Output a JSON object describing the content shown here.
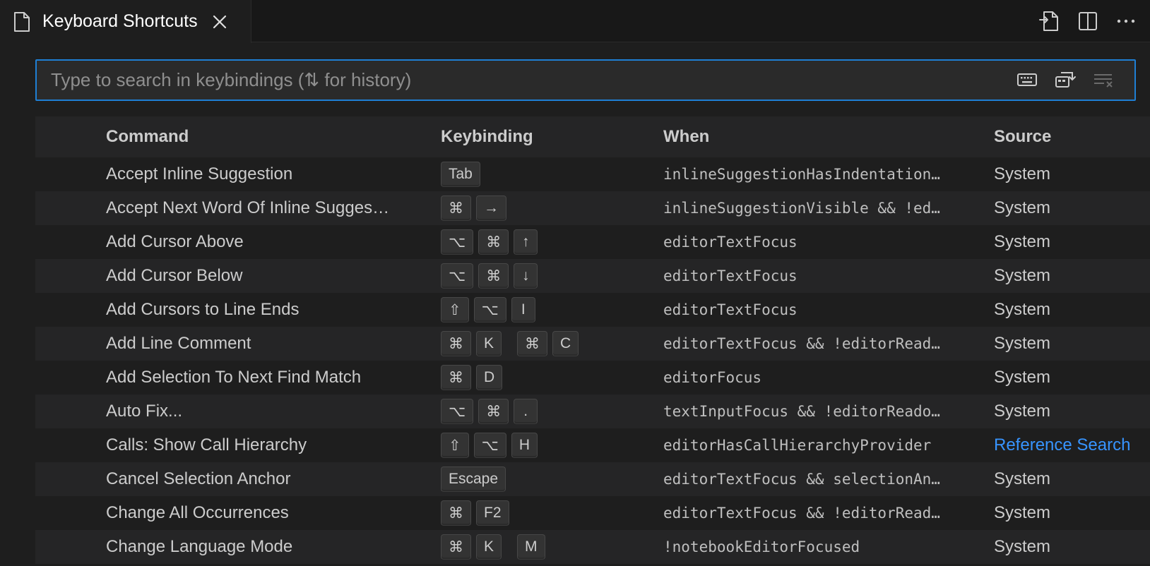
{
  "tab": {
    "title": "Keyboard Shortcuts",
    "file_icon": "file-icon",
    "close_icon": "close-icon"
  },
  "tab_actions": [
    "open-json-icon",
    "split-editor-icon",
    "more-actions-icon"
  ],
  "search": {
    "placeholder": "Type to search in keybindings (⇅ for history)",
    "value": "",
    "actions": [
      "keyboard-icon",
      "sort-by-precedence-icon",
      "clear-search-icon"
    ]
  },
  "table": {
    "headers": {
      "command": "Command",
      "keybinding": "Keybinding",
      "when": "When",
      "source": "Source"
    },
    "rows": [
      {
        "command": "Accept Inline Suggestion",
        "keys": [
          [
            "Tab"
          ]
        ],
        "when": "inlineSuggestionHasIndentation…",
        "source": "System",
        "source_link": false
      },
      {
        "command": "Accept Next Word Of Inline Sugges…",
        "keys": [
          [
            "⌘",
            "→"
          ]
        ],
        "when": "inlineSuggestionVisible && !ed…",
        "source": "System",
        "source_link": false
      },
      {
        "command": "Add Cursor Above",
        "keys": [
          [
            "⌥",
            "⌘",
            "↑"
          ]
        ],
        "when": "editorTextFocus",
        "source": "System",
        "source_link": false
      },
      {
        "command": "Add Cursor Below",
        "keys": [
          [
            "⌥",
            "⌘",
            "↓"
          ]
        ],
        "when": "editorTextFocus",
        "source": "System",
        "source_link": false
      },
      {
        "command": "Add Cursors to Line Ends",
        "keys": [
          [
            "⇧",
            "⌥",
            "I"
          ]
        ],
        "when": "editorTextFocus",
        "source": "System",
        "source_link": false
      },
      {
        "command": "Add Line Comment",
        "keys": [
          [
            "⌘",
            "K"
          ],
          [
            "⌘",
            "C"
          ]
        ],
        "when": "editorTextFocus && !editorRead…",
        "source": "System",
        "source_link": false
      },
      {
        "command": "Add Selection To Next Find Match",
        "keys": [
          [
            "⌘",
            "D"
          ]
        ],
        "when": "editorFocus",
        "source": "System",
        "source_link": false
      },
      {
        "command": "Auto Fix...",
        "keys": [
          [
            "⌥",
            "⌘",
            "."
          ]
        ],
        "when": "textInputFocus && !editorReado…",
        "source": "System",
        "source_link": false
      },
      {
        "command": "Calls: Show Call Hierarchy",
        "keys": [
          [
            "⇧",
            "⌥",
            "H"
          ]
        ],
        "when": "editorHasCallHierarchyProvider",
        "source": "Reference Search",
        "source_link": true
      },
      {
        "command": "Cancel Selection Anchor",
        "keys": [
          [
            "Escape"
          ]
        ],
        "when": "editorTextFocus && selectionAn…",
        "source": "System",
        "source_link": false
      },
      {
        "command": "Change All Occurrences",
        "keys": [
          [
            "⌘",
            "F2"
          ]
        ],
        "when": "editorTextFocus && !editorRead…",
        "source": "System",
        "source_link": false
      },
      {
        "command": "Change Language Mode",
        "keys": [
          [
            "⌘",
            "K"
          ],
          [
            "M"
          ]
        ],
        "when": "!notebookEditorFocused",
        "source": "System",
        "source_link": false
      }
    ]
  },
  "colors": {
    "background": "#1e1e1e",
    "tabbar": "#181818",
    "alt_row": "#252526",
    "accent": "#1f7fd4",
    "link": "#3794ff"
  }
}
